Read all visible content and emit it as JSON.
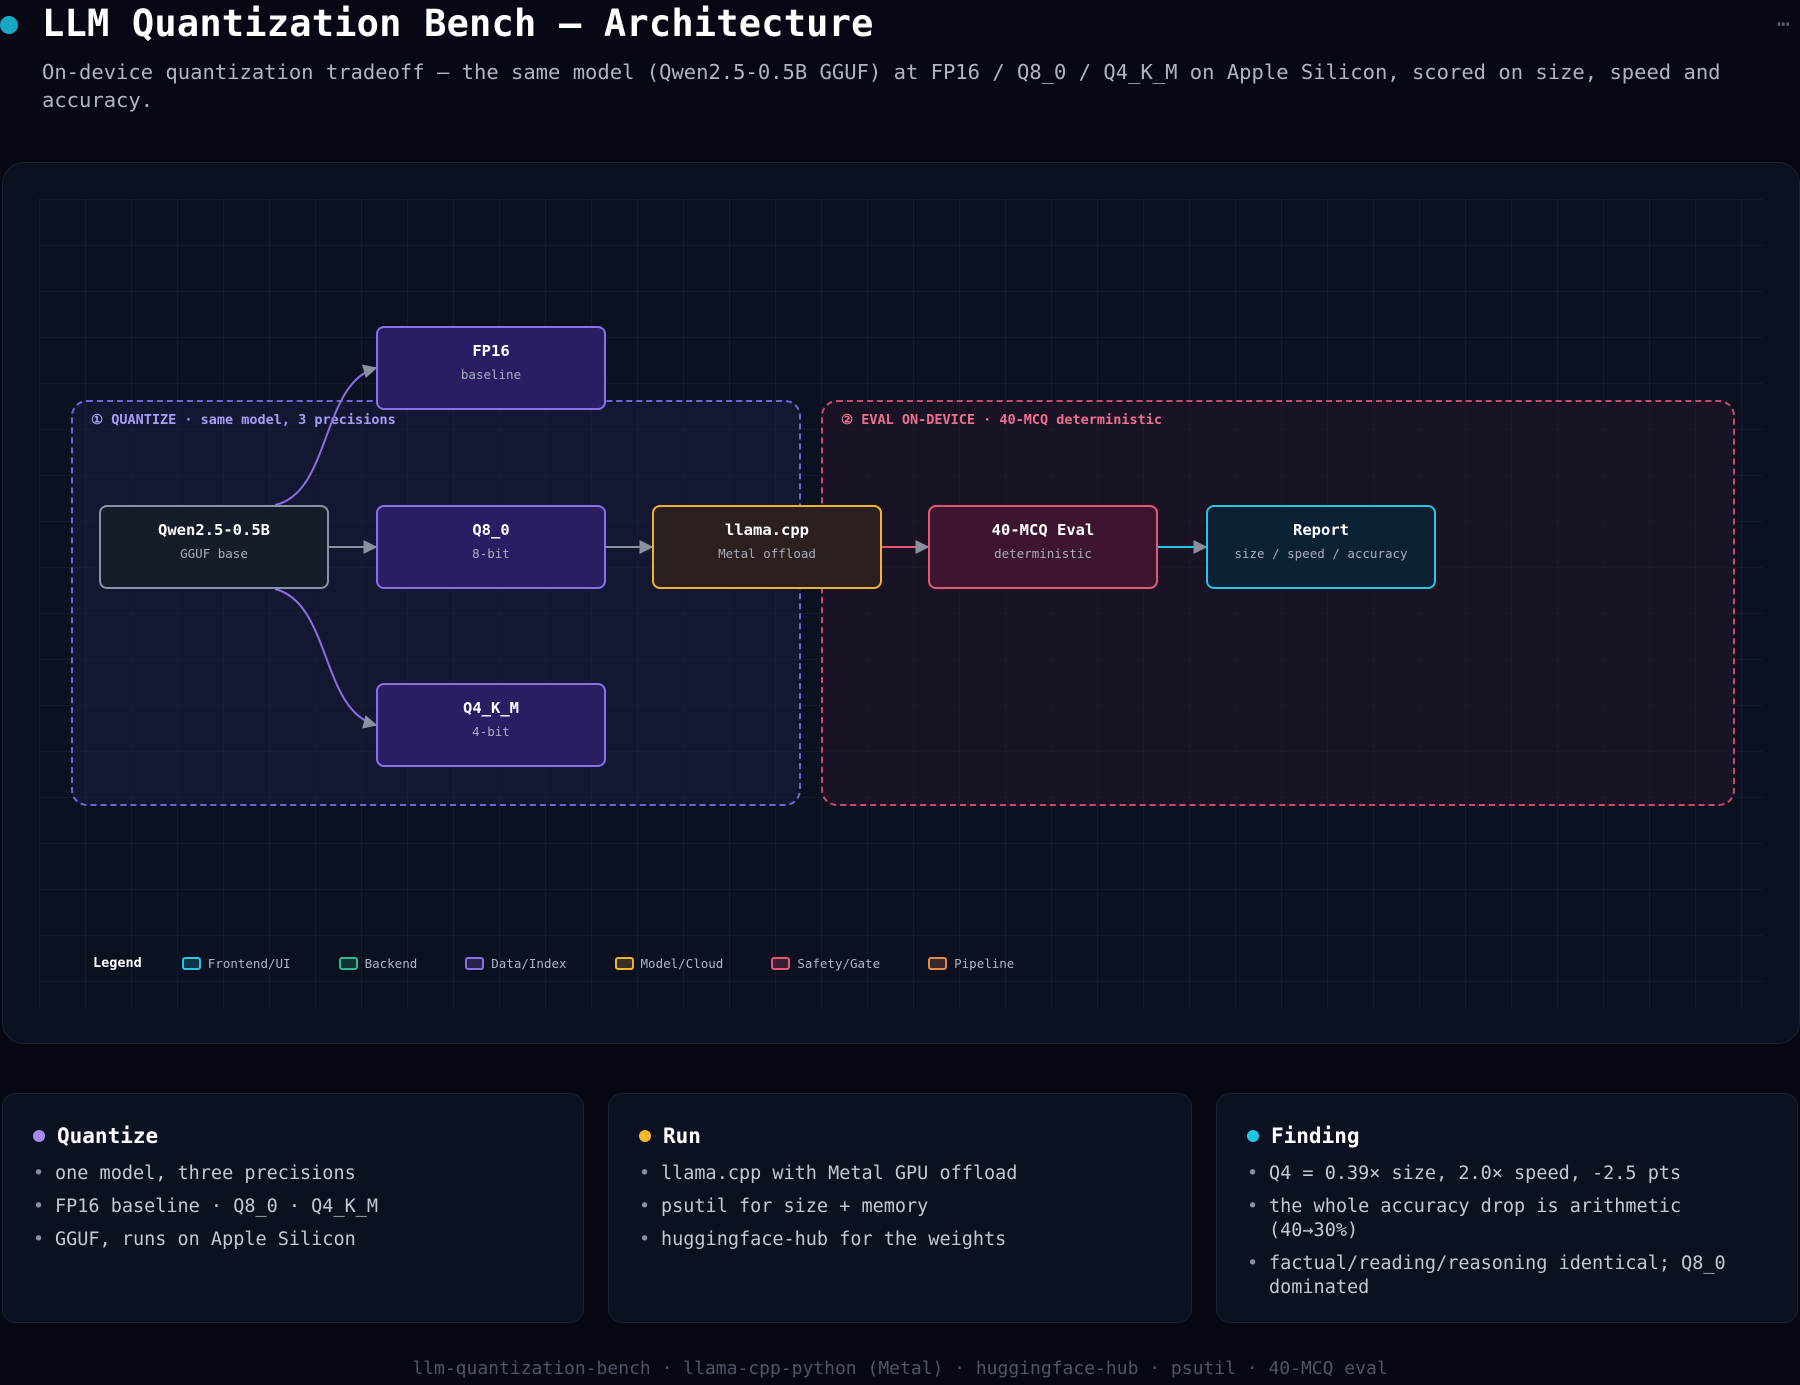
{
  "header": {
    "title": "LLM Quantization Bench — Architecture",
    "subtitle": "On-device quantization tradeoff — the same model (Qwen2.5-0.5B GGUF) at FP16 / Q8_0 / Q4_K_M on Apple Silicon, scored on size, speed and accuracy.",
    "more_icon": "⋯"
  },
  "diagram": {
    "groups": {
      "quantize": "① QUANTIZE · same model, 3 precisions",
      "eval": "② EVAL ON-DEVICE · 40-MCQ deterministic"
    },
    "nodes": {
      "base": {
        "title": "Qwen2.5-0.5B",
        "sub": "GGUF base"
      },
      "fp16": {
        "title": "FP16",
        "sub": "baseline"
      },
      "q8": {
        "title": "Q8_0",
        "sub": "8-bit"
      },
      "q4": {
        "title": "Q4_K_M",
        "sub": "4-bit"
      },
      "llama": {
        "title": "llama.cpp",
        "sub": "Metal offload"
      },
      "eval": {
        "title": "40-MCQ Eval",
        "sub": "deterministic"
      },
      "report": {
        "title": "Report",
        "sub": "size / speed / accuracy"
      }
    },
    "legend": {
      "title": "Legend",
      "items": [
        {
          "label": "Frontend/UI",
          "color": "#24c6e0"
        },
        {
          "label": "Backend",
          "color": "#2fb892"
        },
        {
          "label": "Data/Index",
          "color": "#8b6fe6"
        },
        {
          "label": "Model/Cloud",
          "color": "#f0b430"
        },
        {
          "label": "Safety/Gate",
          "color": "#e55876"
        },
        {
          "label": "Pipeline",
          "color": "#e08a4a"
        }
      ]
    }
  },
  "cards": [
    {
      "title": "Quantize",
      "dot_color": "#a78bfa",
      "items": [
        "one model, three precisions",
        "FP16 baseline · Q8_0 · Q4_K_M",
        "GGUF, runs on Apple Silicon"
      ]
    },
    {
      "title": "Run",
      "dot_color": "#f5b82e",
      "items": [
        "llama.cpp with Metal GPU offload",
        "psutil for size + memory",
        "huggingface-hub for the weights"
      ]
    },
    {
      "title": "Finding",
      "dot_color": "#22c5e0",
      "items": [
        "Q4 = 0.39× size, 2.0× speed, -2.5 pts",
        "the whole accuracy drop is arithmetic (40→30%)",
        "factual/reading/reasoning identical; Q8_0 dominated"
      ]
    }
  ],
  "footer": "llm-quantization-bench · llama-cpp-python (Metal) · huggingface-hub · psutil · 40-MCQ eval"
}
